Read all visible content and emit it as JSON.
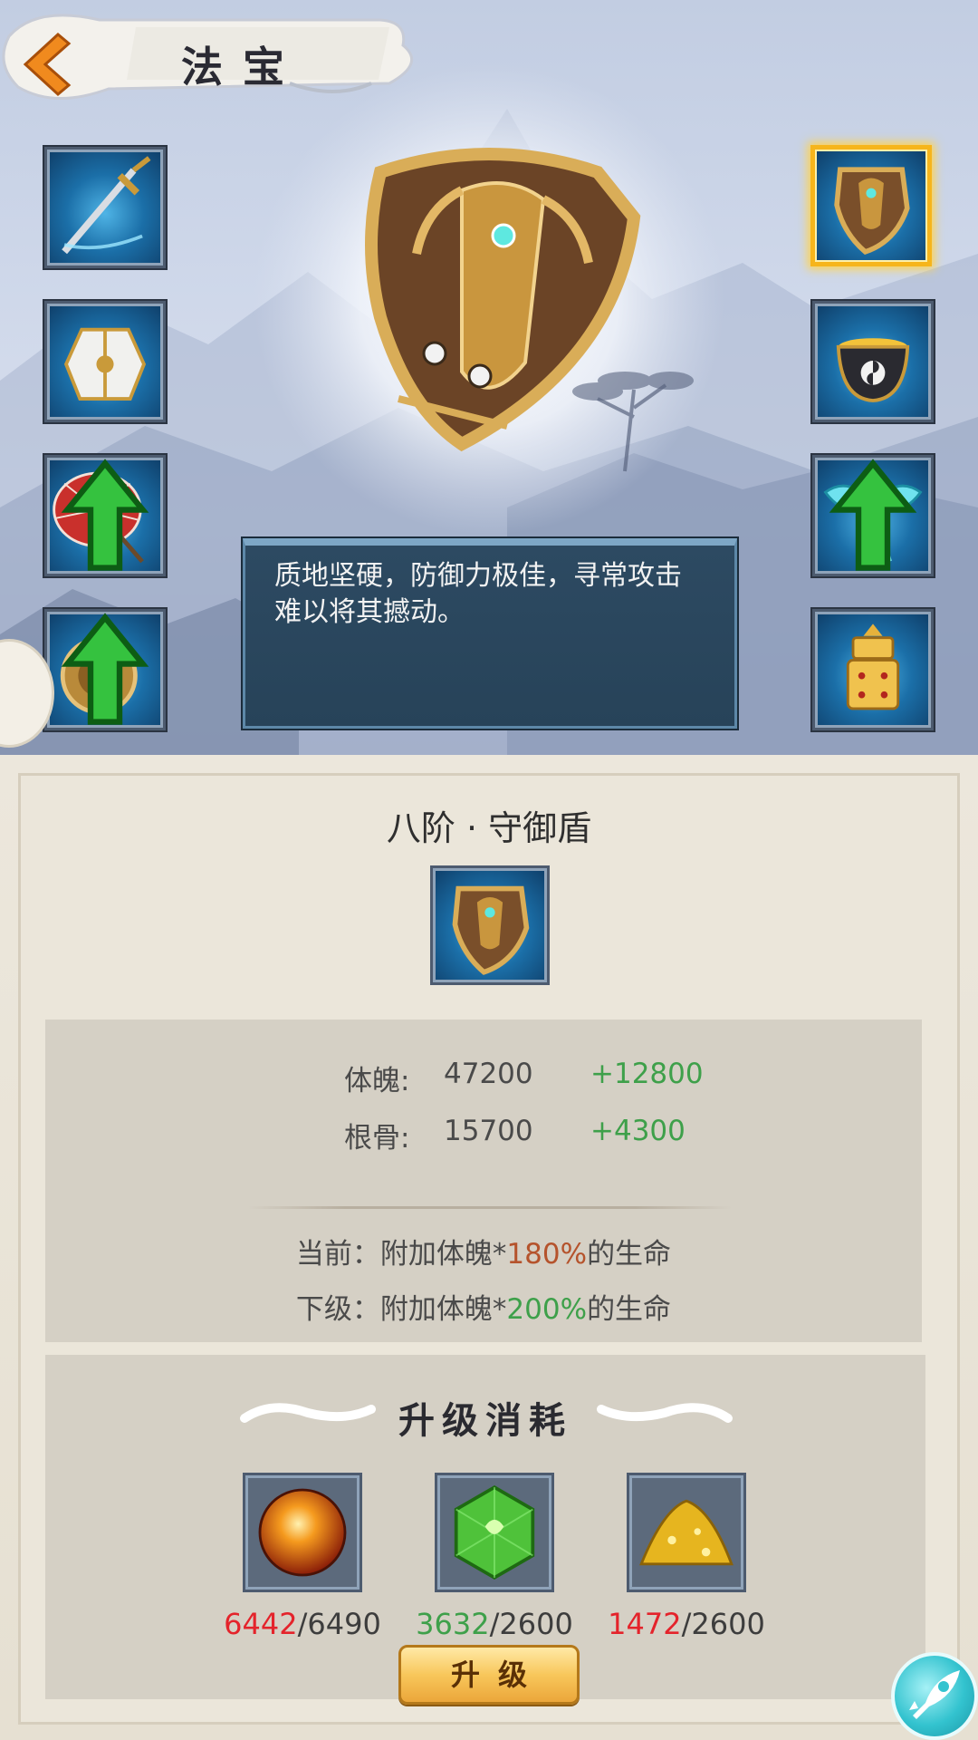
{
  "header": {
    "title": "法宝",
    "back_icon": "back-arrow-icon"
  },
  "slots_left": [
    {
      "name": "sword",
      "icon": "sword-icon",
      "upgradable": false
    },
    {
      "name": "robe",
      "icon": "robe-icon",
      "upgradable": false
    },
    {
      "name": "umbrella",
      "icon": "umbrella-icon",
      "upgradable": true
    },
    {
      "name": "bell",
      "icon": "bell-icon",
      "upgradable": true
    }
  ],
  "slots_right": [
    {
      "name": "shield",
      "icon": "shield-icon",
      "upgradable": false,
      "selected": true
    },
    {
      "name": "cauldron",
      "icon": "cauldron-icon",
      "upgradable": false
    },
    {
      "name": "ribbon",
      "icon": "ribbon-icon",
      "upgradable": true
    },
    {
      "name": "pagoda",
      "icon": "pagoda-icon",
      "upgradable": false
    }
  ],
  "description": "质地坚硬，防御力极佳，寻常攻击难以将其撼动。",
  "item": {
    "title": "八阶 · 守御盾",
    "icon": "shield-icon"
  },
  "stats": [
    {
      "label": "体魄:",
      "value": "47200",
      "add": "+12800"
    },
    {
      "label": "根骨:",
      "value": "15700",
      "add": "+4300"
    }
  ],
  "effects": {
    "current_prefix": "当前：附加体魄*",
    "current_pct": "180%",
    "current_suffix": "的生命",
    "next_prefix": "下级：附加体魄*",
    "next_pct": "200%",
    "next_suffix": "的生命"
  },
  "cost": {
    "title": "升级消耗",
    "materials": [
      {
        "icon": "fire-orb-icon",
        "have": "6442",
        "need": "/6490",
        "enough": false
      },
      {
        "icon": "green-gem-icon",
        "have": "3632",
        "need": "/2600",
        "enough": true
      },
      {
        "icon": "gold-dust-icon",
        "have": "1472",
        "need": "/2600",
        "enough": false
      }
    ],
    "button_label": "升级"
  },
  "colors": {
    "accent_gold": "#f6b51c",
    "green": "#3ea04a",
    "red": "#e4232b",
    "desc_bg": "#2d4a62"
  }
}
